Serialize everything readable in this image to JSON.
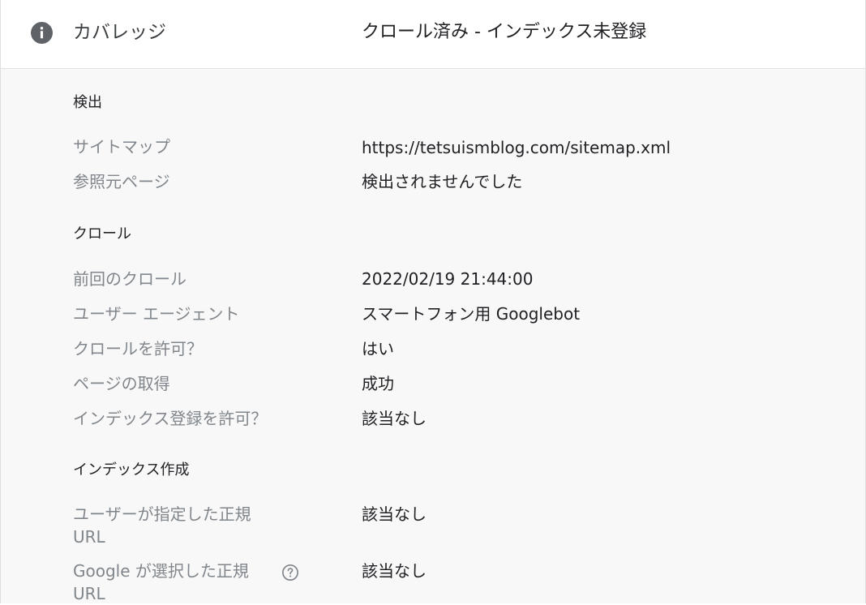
{
  "header": {
    "label": "カバレッジ",
    "value": "クロール済み - インデックス未登録",
    "icon": "info-icon"
  },
  "discovery": {
    "title": "検出",
    "sitemap_label": "サイトマップ",
    "sitemap_value": "https://tetsuismblog.com/sitemap.xml",
    "referring_label": "参照元ページ",
    "referring_value": "検出されませんでした"
  },
  "crawl": {
    "title": "クロール",
    "last_crawl_label": "前回のクロール",
    "last_crawl_value": "2022/02/19 21:44:00",
    "user_agent_label": "ユーザー エージェント",
    "user_agent_value": "スマートフォン用 Googlebot",
    "crawl_allowed_label": "クロールを許可？",
    "crawl_allowed_value": "はい",
    "page_fetch_label": "ページの取得",
    "page_fetch_value": "成功",
    "indexing_allowed_label": "インデックス登録を許可？",
    "indexing_allowed_value": "該当なし"
  },
  "indexing": {
    "title": "インデックス作成",
    "user_canonical_label_line1": "ユーザーが指定した正規",
    "user_canonical_label_line2": "URL",
    "user_canonical_value": "該当なし",
    "google_canonical_label_line1": "Google が選択した正規",
    "google_canonical_label_line2": "URL",
    "google_canonical_value": "該当なし",
    "help_icon": "help-circle-icon"
  },
  "colors": {
    "label_gray": "#80868b",
    "value_dark": "#202124",
    "icon_gray": "#5f6368",
    "panel_bg": "#f8f8f8"
  }
}
